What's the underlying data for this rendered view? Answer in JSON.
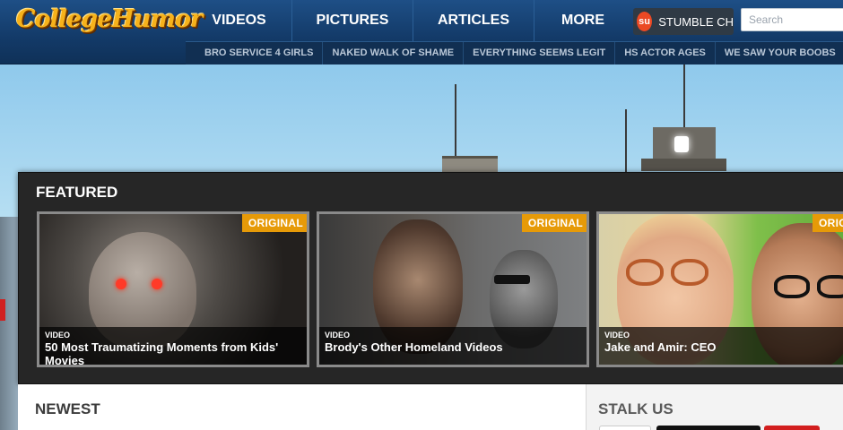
{
  "header": {
    "logo_text": "CollegeHumor",
    "nav": [
      {
        "label": "VIDEOS"
      },
      {
        "label": "PICTURES"
      },
      {
        "label": "ARTICLES"
      },
      {
        "label": "MORE"
      }
    ],
    "stumble": {
      "label": "STUMBLE CH",
      "icon": "stumbleupon-icon",
      "icon_glyph": "su"
    },
    "search": {
      "placeholder": "Search"
    },
    "sub_nav": [
      {
        "label": "BRO SERVICE 4 GIRLS"
      },
      {
        "label": "NAKED WALK OF SHAME"
      },
      {
        "label": "EVERYTHING SEEMS LEGIT"
      },
      {
        "label": "HS ACTOR AGES"
      },
      {
        "label": "WE SAW YOUR BOOBS"
      }
    ]
  },
  "featured": {
    "title": "FEATURED",
    "cards": [
      {
        "badge": "ORIGINAL",
        "type": "VIDEO",
        "title": "50 Most Traumatizing Moments from Kids' Movies"
      },
      {
        "badge": "ORIGINAL",
        "type": "VIDEO",
        "title": "Brody's Other Homeland Videos"
      },
      {
        "badge": "ORIGINAL",
        "type": "VIDEO",
        "title": "Jake and Amir: CEO"
      }
    ]
  },
  "sections": {
    "newest": "NEWEST",
    "stalk_us": "STALK US"
  },
  "colors": {
    "header_bg": "#133a68",
    "logo": "#f6b21b",
    "badge": "#e69a08",
    "panel_bg": "#262626"
  }
}
